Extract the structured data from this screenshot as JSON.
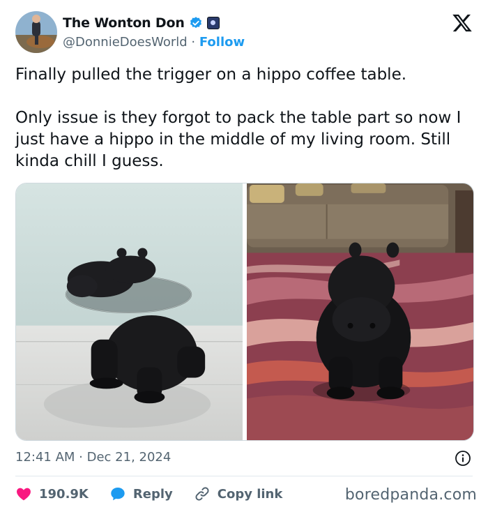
{
  "author": {
    "display_name": "The Wonton Don",
    "handle": "@DonnieDoesWorld",
    "separator": " · ",
    "follow_label": "Follow"
  },
  "tweet": {
    "paragraphs": [
      "Finally pulled the trigger on a hippo coffee table.",
      "Only issue is they forgot to pack the table part so now I just have a hippo in the middle of my living room. Still kinda chill I guess."
    ],
    "time": "12:41 AM",
    "time_separator": " · ",
    "date": "Dec 21, 2024"
  },
  "actions": {
    "likes": "190.9K",
    "reply_label": "Reply",
    "copy_link_label": "Copy link"
  },
  "watermark": "boredpanda.com",
  "icons": {
    "verified": "verified-badge-icon",
    "affiliate": "affiliate-badge-icon",
    "brand": "x-logo-icon",
    "info": "info-icon",
    "like": "heart-icon",
    "reply": "reply-bubble-icon",
    "copy": "link-icon"
  },
  "colors": {
    "accent": "#1d9bf0",
    "like": "#f91880",
    "text": "#0f1419",
    "secondary": "#536471"
  }
}
